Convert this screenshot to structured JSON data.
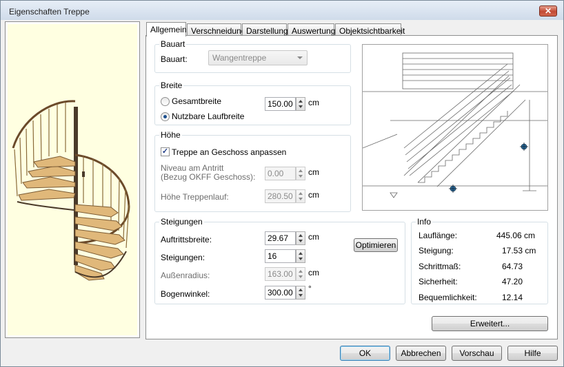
{
  "window": {
    "title": "Eigenschaften Treppe",
    "close_label": "✕"
  },
  "tabs": [
    {
      "label": "Allgemein"
    },
    {
      "label": "Verschneidung"
    },
    {
      "label": "Darstellung"
    },
    {
      "label": "Auswertung"
    },
    {
      "label": "Objektsichtbarkeit"
    }
  ],
  "bauart": {
    "group": "Bauart",
    "label": "Bauart:",
    "value": "Wangentreppe"
  },
  "breite": {
    "group": "Breite",
    "gesamt_label": "Gesamtbreite",
    "nutzbar_label": "Nutzbare Laufbreite",
    "value": "150.00",
    "unit": "cm",
    "selected": "Nutzbare Laufbreite"
  },
  "hoehe": {
    "group": "Höhe",
    "anpassen_label": "Treppe an Geschoss anpassen",
    "anpassen_checked": true,
    "niveau_label_1": "Niveau am Antritt",
    "niveau_label_2": "(Bezug OKFF Geschoss):",
    "niveau_value": "0.00",
    "niveau_unit": "cm",
    "lauf_label": "Höhe Treppenlauf:",
    "lauf_value": "280.50",
    "lauf_unit": "cm"
  },
  "steigungen": {
    "group": "Steigungen",
    "auftritt_label": "Auftrittsbreite:",
    "auftritt_value": "29.67",
    "auftritt_unit": "cm",
    "steig_label": "Steigungen:",
    "steig_value": "16",
    "radius_label": "Außenradius:",
    "radius_value": "163.00",
    "radius_unit": "cm",
    "bogen_label": "Bogenwinkel:",
    "bogen_value": "300.00",
    "bogen_unit": "°",
    "optimieren_label": "Optimieren"
  },
  "info": {
    "group": "Info",
    "rows": [
      {
        "label": "Lauflänge:",
        "value": "445.06 cm"
      },
      {
        "label": "Steigung:",
        "value": "17.53 cm"
      },
      {
        "label": "Schrittmaß:",
        "value": "64.73"
      },
      {
        "label": "Sicherheit:",
        "value": "47.20"
      },
      {
        "label": "Bequemlichkeit:",
        "value": "12.14"
      }
    ]
  },
  "erweitert_label": "Erweitert...",
  "buttons": {
    "ok": "OK",
    "abbrechen": "Abbrechen",
    "vorschau": "Vorschau",
    "hilfe": "Hilfe"
  },
  "icons": {
    "close": "close-icon",
    "spinner": "spinner-arrows-icon",
    "dropdown": "chevron-down-icon"
  },
  "colors": {
    "preview_bg": "#ffffe1",
    "stair_wood": "#e0b87a",
    "stair_dark": "#4a3a2a"
  }
}
